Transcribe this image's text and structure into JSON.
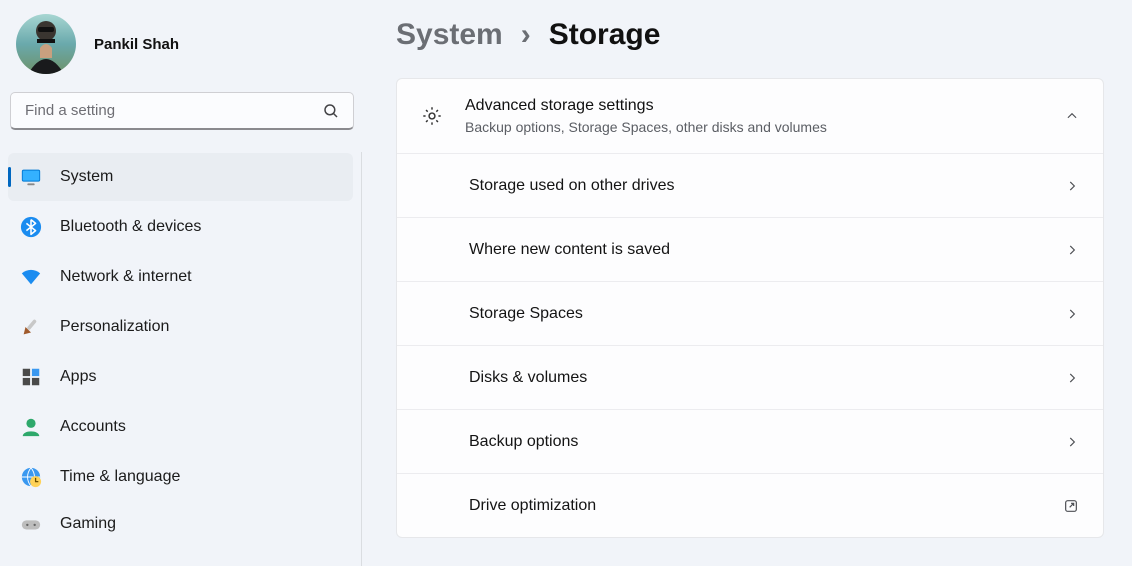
{
  "user": {
    "name": "Pankil Shah"
  },
  "search": {
    "placeholder": "Find a setting"
  },
  "sidebar": {
    "items": [
      {
        "label": "System"
      },
      {
        "label": "Bluetooth & devices"
      },
      {
        "label": "Network & internet"
      },
      {
        "label": "Personalization"
      },
      {
        "label": "Apps"
      },
      {
        "label": "Accounts"
      },
      {
        "label": "Time & language"
      },
      {
        "label": "Gaming"
      }
    ],
    "active_index": 0
  },
  "breadcrumb": {
    "root": "System",
    "sep": "›",
    "leaf": "Storage"
  },
  "card": {
    "icon": "gear-icon",
    "title": "Advanced storage settings",
    "subtitle": "Backup options, Storage Spaces, other disks and volumes",
    "expanded": true,
    "items": [
      {
        "label": "Storage used on other drives",
        "action": "navigate"
      },
      {
        "label": "Where new content is saved",
        "action": "navigate"
      },
      {
        "label": "Storage Spaces",
        "action": "navigate"
      },
      {
        "label": "Disks & volumes",
        "action": "navigate"
      },
      {
        "label": "Backup options",
        "action": "navigate"
      },
      {
        "label": "Drive optimization",
        "action": "external"
      }
    ]
  }
}
